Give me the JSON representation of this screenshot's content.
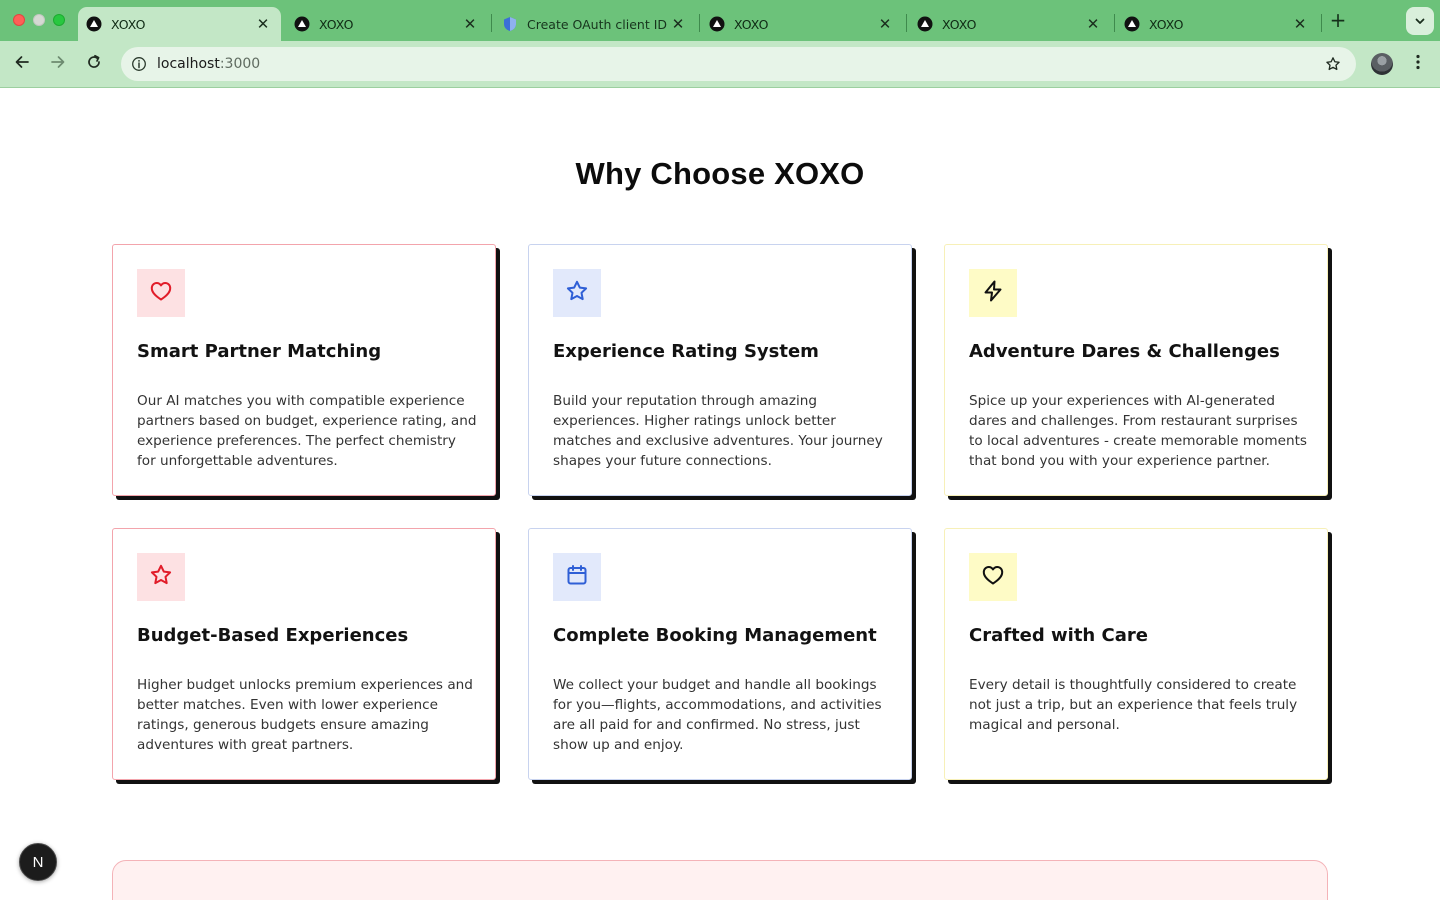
{
  "browser": {
    "tabs": [
      {
        "title": "XOXO",
        "active": true,
        "favicon": "triangle-logo-icon"
      },
      {
        "title": "XOXO",
        "active": false,
        "favicon": "triangle-logo-icon"
      },
      {
        "title": "Create OAuth client ID –",
        "active": false,
        "favicon": "shield-icon"
      },
      {
        "title": "XOXO",
        "active": false,
        "favicon": "triangle-logo-icon"
      },
      {
        "title": "XOXO",
        "active": false,
        "favicon": "triangle-logo-icon"
      },
      {
        "title": "XOXO",
        "active": false,
        "favicon": "triangle-logo-icon"
      }
    ],
    "new_tab_label": "+",
    "close_label": "✕",
    "url_host": "localhost",
    "url_port": ":3000",
    "colors": {
      "tabbar": "#6cc27a",
      "toolbar": "#c3e7c6"
    }
  },
  "page": {
    "title": "Why Choose XOXO",
    "features": [
      {
        "icon": "heart-icon",
        "accent": "red",
        "title": "Smart Partner Matching",
        "description": "Our AI matches you with compatible experience partners based on budget, experience rating, and experience preferences. The perfect chemistry for unforgettable adventures."
      },
      {
        "icon": "star-icon",
        "accent": "blue",
        "title": "Experience Rating System",
        "description": "Build your reputation through amazing experiences. Higher ratings unlock better matches and exclusive adventures. Your journey shapes your future connections."
      },
      {
        "icon": "lightning-icon",
        "accent": "yellow",
        "title": "Adventure Dares & Challenges",
        "description": "Spice up your experiences with AI-generated dares and challenges. From restaurant surprises to local adventures - create memorable moments that bond you with your experience partner."
      },
      {
        "icon": "star-icon",
        "accent": "red",
        "title": "Budget-Based Experiences",
        "description": "Higher budget unlocks premium experiences and better matches. Even with lower experience ratings, generous budgets ensure amazing adventures with great partners."
      },
      {
        "icon": "calendar-icon",
        "accent": "blue",
        "title": "Complete Booking Management",
        "description": "We collect your budget and handle all bookings for you—flights, accommodations, and activities are all paid for and confirmed. No stress, just show up and enjoy."
      },
      {
        "icon": "heart-icon",
        "accent": "yellow",
        "title": "Crafted with Care",
        "description": "Every detail is thoughtfully considered to create not just a trip, but an experience that feels truly magical and personal."
      }
    ],
    "colors": {
      "red": "#e11d2a",
      "blue": "#2f5fd6",
      "yellow": "#111111"
    }
  },
  "dev_badge": {
    "label": "N"
  }
}
